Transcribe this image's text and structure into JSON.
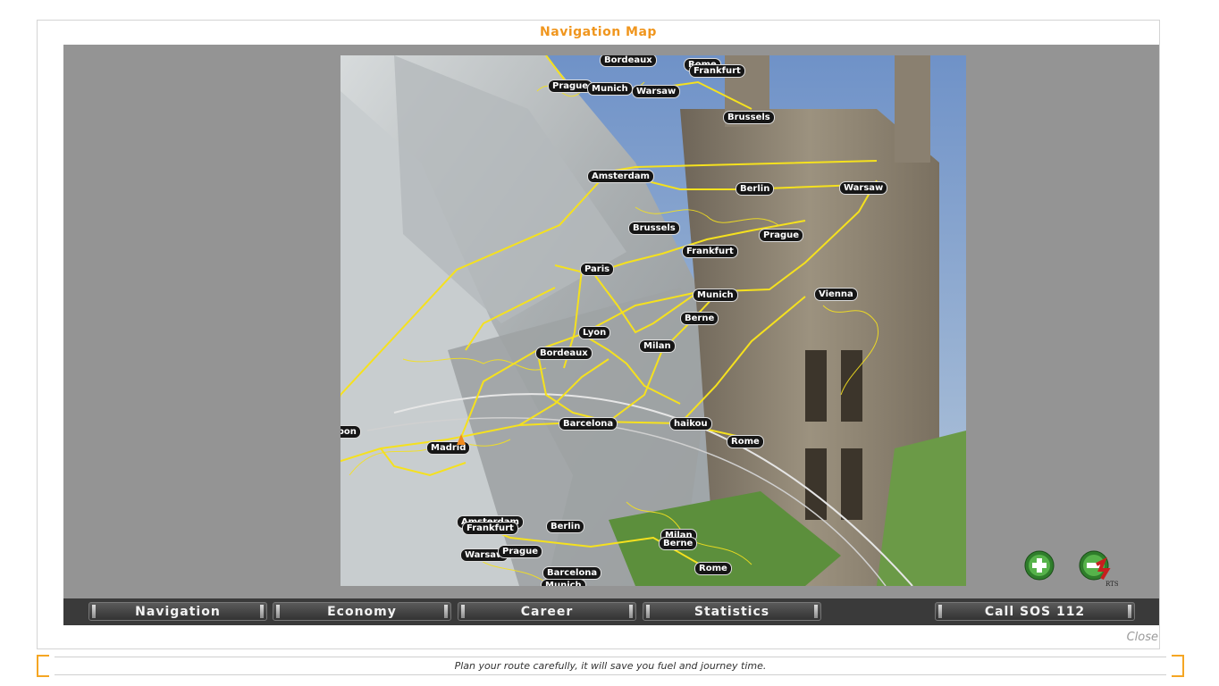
{
  "window": {
    "title": "Navigation Map"
  },
  "map": {
    "cities": [
      {
        "name": "Bordeaux"
      },
      {
        "name": "Rome"
      },
      {
        "name": "Frankfurt"
      },
      {
        "name": "Prague"
      },
      {
        "name": "Munich"
      },
      {
        "name": "Warsaw"
      },
      {
        "name": "Brussels"
      },
      {
        "name": "Amsterdam"
      },
      {
        "name": "Berlin"
      },
      {
        "name": "Warsaw"
      },
      {
        "name": "Brussels"
      },
      {
        "name": "Prague"
      },
      {
        "name": "Frankfurt"
      },
      {
        "name": "Paris"
      },
      {
        "name": "Munich"
      },
      {
        "name": "Vienna"
      },
      {
        "name": "Berne"
      },
      {
        "name": "Lyon"
      },
      {
        "name": "Milan"
      },
      {
        "name": "Bordeaux"
      },
      {
        "name": "Lisbon"
      },
      {
        "name": "Barcelona"
      },
      {
        "name": "haikou"
      },
      {
        "name": "Madrid"
      },
      {
        "name": "Rome"
      },
      {
        "name": "Amsterdam"
      },
      {
        "name": "Frankfurt"
      },
      {
        "name": "Berlin"
      },
      {
        "name": "Milan"
      },
      {
        "name": "Berne"
      },
      {
        "name": "Warsaw"
      },
      {
        "name": "Prague"
      },
      {
        "name": "Barcelona"
      },
      {
        "name": "Rome"
      },
      {
        "name": "Munich"
      }
    ],
    "zoom_in_icon": "plus-icon",
    "rts_icon": "rts-icon",
    "rts_label": "RTS"
  },
  "toolbar": {
    "navigation": "Navigation",
    "economy": "Economy",
    "career": "Career",
    "statistics": "Statistics",
    "sos": "Call SOS 112"
  },
  "close_label": "Close",
  "hint": "Plan your route carefully, it will save you fuel and journey time.",
  "colors": {
    "accent": "#f0961e",
    "route": "#f5e11e"
  }
}
